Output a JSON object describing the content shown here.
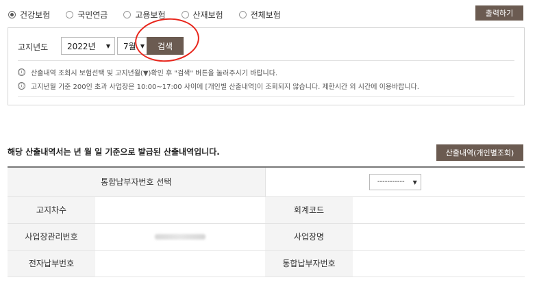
{
  "insurance_types": [
    {
      "label": "건강보험",
      "checked": true
    },
    {
      "label": "국민연금",
      "checked": false
    },
    {
      "label": "고용보험",
      "checked": false
    },
    {
      "label": "산재보험",
      "checked": false
    },
    {
      "label": "전체보험",
      "checked": false
    }
  ],
  "toolbar": {
    "print_label": "출력하기"
  },
  "search": {
    "year_label": "고지년도",
    "year_value": "2022년",
    "month_value": "7월",
    "search_label": "검색",
    "note_icon": "ⓘ",
    "note1": "산출내역 조회시 보험선택 및 고지년월(▼)확인 후 \"검색\" 버튼을 눌러주시기 바랍니다.",
    "note2": "고지년월 기준 200인 초과 사업장은 10:00~17:00 사이에 [개인별 산출내역]이 조회되지 않습니다. 제한시간 외 시간에 이용바랍니다."
  },
  "section": {
    "title": "해당 산출내역서는 년 월 일 기준으로 발급된 산출내역입니다.",
    "detail_button": "산출내역(개인별조회)"
  },
  "table": {
    "selector_label": "통합납부자번호 선택",
    "selector_value": "-----------",
    "rows": [
      {
        "h1": "고지차수",
        "v1": "",
        "h2": "회계코드",
        "v2": ""
      },
      {
        "h1": "사업장관리번호",
        "v1": "",
        "h2": "사업장명",
        "v2": ""
      },
      {
        "h1": "전자납부번호",
        "v1": "",
        "h2": "통합납부자번호",
        "v2": ""
      }
    ]
  },
  "colors": {
    "accent_brown": "#6b5b51",
    "highlight_red": "#e8251b"
  }
}
